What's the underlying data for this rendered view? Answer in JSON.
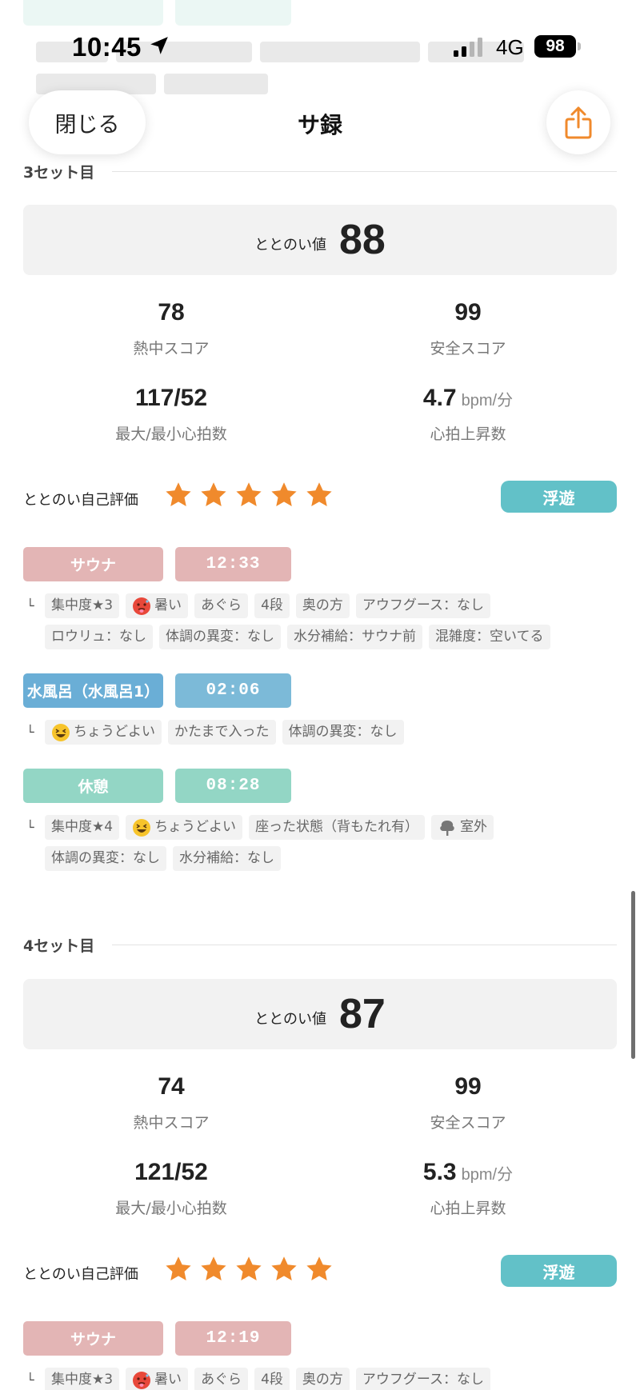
{
  "status_bar": {
    "time": "10:45",
    "network": "4G",
    "battery": "98"
  },
  "nav": {
    "close_label": "閉じる",
    "title": "サ録"
  },
  "sets": [
    {
      "title": "3セット目",
      "totonoi_label": "ととのい値",
      "totonoi_value": "88",
      "heat_score": "78",
      "heat_label": "熱中スコア",
      "safety_score": "99",
      "safety_label": "安全スコア",
      "heart_rate": "117/52",
      "heart_rate_label": "最大/最小心拍数",
      "hr_rise": "4.7",
      "hr_rise_unit": "bpm/分",
      "hr_rise_label": "心拍上昇数",
      "eval_label": "ととのい自己評価",
      "rating": 5,
      "badge": "浮遊",
      "steps": [
        {
          "type": "サウナ",
          "time": "12:33",
          "tag_lines": [
            [
              "集中度★3",
              "暑い",
              "あぐら",
              "4段",
              "奥の方",
              "アウフグース：なし"
            ],
            [
              "ロウリュ：なし",
              "体調の異変：なし",
              "水分補給：サウナ前",
              "混雑度：空いてる"
            ]
          ]
        },
        {
          "type": "水風呂（水風呂1）",
          "time": "02:06",
          "tag_lines": [
            [
              "ちょうどよい",
              "かたまで入った",
              "体調の異変：なし"
            ]
          ]
        },
        {
          "type": "休憩",
          "time": "08:28",
          "tag_lines": [
            [
              "集中度★4",
              "ちょうどよい",
              "座った状態（背もたれ有）",
              "室外"
            ],
            [
              "体調の異変：なし",
              "水分補給：なし"
            ]
          ]
        }
      ]
    },
    {
      "title": "4セット目",
      "totonoi_label": "ととのい値",
      "totonoi_value": "87",
      "heat_score": "74",
      "heat_label": "熱中スコア",
      "safety_score": "99",
      "safety_label": "安全スコア",
      "heart_rate": "121/52",
      "heart_rate_label": "最大/最小心拍数",
      "hr_rise": "5.3",
      "hr_rise_unit": "bpm/分",
      "hr_rise_label": "心拍上昇数",
      "eval_label": "ととのい自己評価",
      "rating": 5,
      "badge": "浮遊",
      "steps": [
        {
          "type": "サウナ",
          "time": "12:19",
          "tag_lines": [
            [
              "集中度★3",
              "暑い",
              "あぐら",
              "4段",
              "奥の方",
              "アウフグース：なし"
            ]
          ]
        }
      ]
    }
  ],
  "icons": {
    "location": "location-arrow-icon",
    "share": "share-icon",
    "star": "star-icon",
    "hot_face": "hot-face-emoji",
    "grin_face": "grinning-squint-emoji",
    "tree": "tree-icon"
  },
  "colors": {
    "accent": "#f08a2c",
    "badge": "#62c1c8",
    "sauna": "#e3b5b5",
    "water": "#6aaed6",
    "rest": "#93d6c5"
  }
}
